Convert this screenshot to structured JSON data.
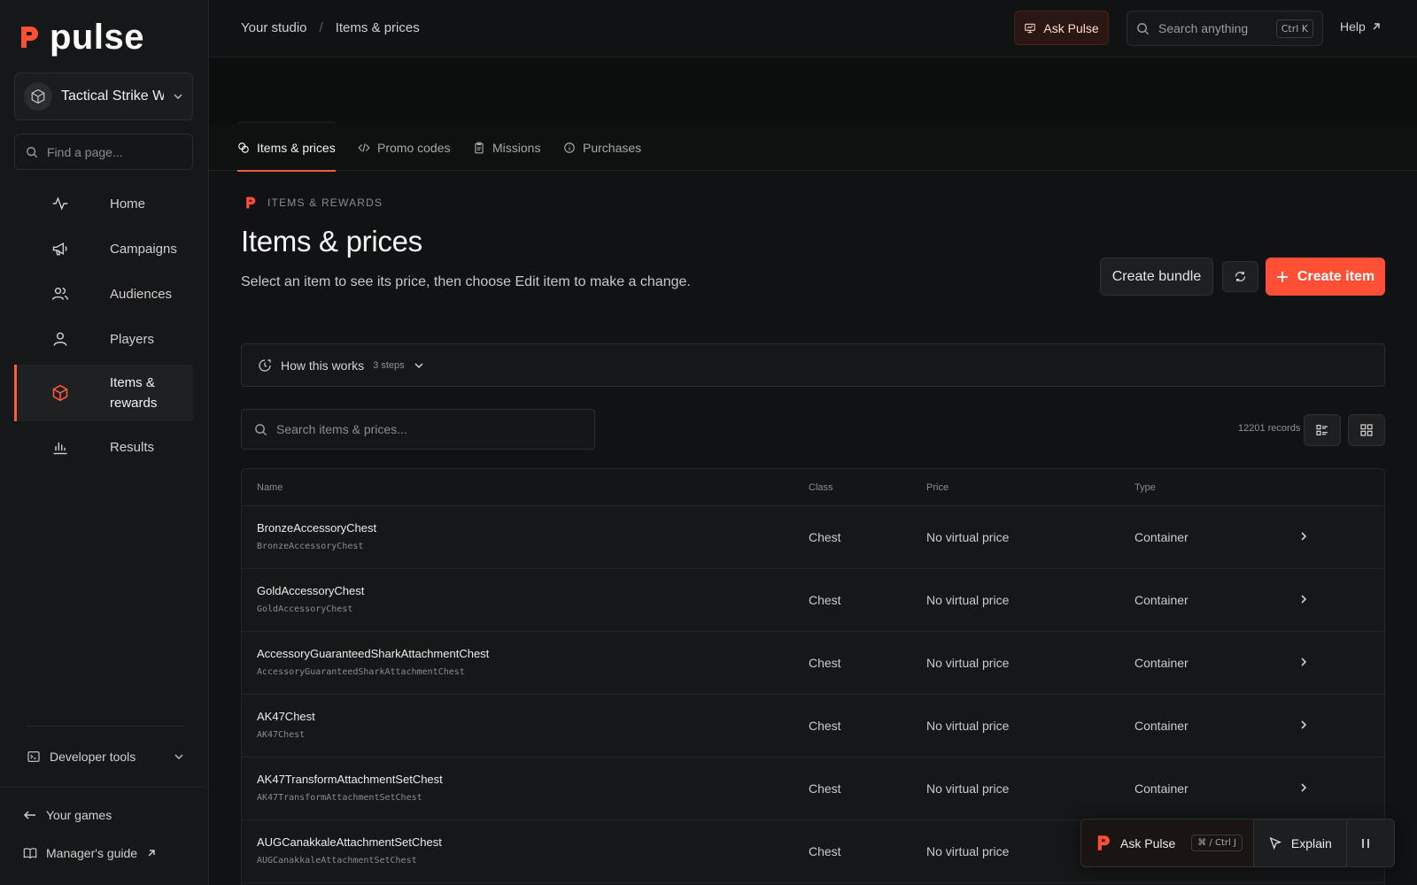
{
  "app": {
    "logo_text": "pulse"
  },
  "sidebar": {
    "project_name": "Tactical Strike W",
    "find_placeholder": "Find a page...",
    "items": [
      {
        "label": "Home",
        "icon": "activity-icon"
      },
      {
        "label": "Campaigns",
        "icon": "megaphone-icon"
      },
      {
        "label": "Audiences",
        "icon": "users-icon"
      },
      {
        "label": "Players",
        "icon": "user-icon"
      },
      {
        "label": "Items & rewards",
        "icon": "box-icon",
        "active": true
      },
      {
        "label": "Results",
        "icon": "bar-chart-icon"
      }
    ],
    "developer_tools": "Developer tools",
    "your_games": "Your games",
    "managers_guide": "Manager's guide"
  },
  "topbar": {
    "breadcrumb": [
      "Your studio",
      "Items & prices"
    ],
    "ask_pulse": "Ask Pulse",
    "search_placeholder": "Search anything",
    "search_shortcut": "Ctrl K",
    "help": "Help"
  },
  "tabs": [
    {
      "label": "Items & prices",
      "active": true
    },
    {
      "label": "Promo codes"
    },
    {
      "label": "Missions"
    },
    {
      "label": "Purchases"
    }
  ],
  "header": {
    "eyebrow": "ITEMS & REWARDS",
    "title": "Items & prices",
    "subtitle": "Select an item to see its price, then choose Edit item to make a change.",
    "create_bundle": "Create bundle",
    "create_item": "Create item"
  },
  "how_it_works": {
    "label": "How this works",
    "steps": "3 steps"
  },
  "list": {
    "search_placeholder": "Search items & prices...",
    "records": "12201 records"
  },
  "table": {
    "columns": [
      "Name",
      "Class",
      "Price",
      "Type"
    ],
    "rows": [
      {
        "name": "BronzeAccessoryChest",
        "id": "BronzeAccessoryChest",
        "class": "Chest",
        "price": "No virtual price",
        "type": "Container"
      },
      {
        "name": "GoldAccessoryChest",
        "id": "GoldAccessoryChest",
        "class": "Chest",
        "price": "No virtual price",
        "type": "Container"
      },
      {
        "name": "AccessoryGuaranteedSharkAttachmentChest",
        "id": "AccessoryGuaranteedSharkAttachmentChest",
        "class": "Chest",
        "price": "No virtual price",
        "type": "Container"
      },
      {
        "name": "AK47Chest",
        "id": "AK47Chest",
        "class": "Chest",
        "price": "No virtual price",
        "type": "Container"
      },
      {
        "name": "AK47TransformAttachmentSetChest",
        "id": "AK47TransformAttachmentSetChest",
        "class": "Chest",
        "price": "No virtual price",
        "type": "Container"
      },
      {
        "name": "AUGCanakkaleAttachmentSetChest",
        "id": "AUGCanakkaleAttachmentSetChest",
        "class": "Chest",
        "price": "No virtual price",
        "type": ""
      }
    ]
  },
  "ask_bar": {
    "ask_label": "Ask Pulse",
    "shortcut": "⌘ / Ctrl J",
    "explain": "Explain"
  },
  "colors": {
    "accent": "#ff4f34",
    "background": "#111213",
    "sidebar": "#161718"
  }
}
